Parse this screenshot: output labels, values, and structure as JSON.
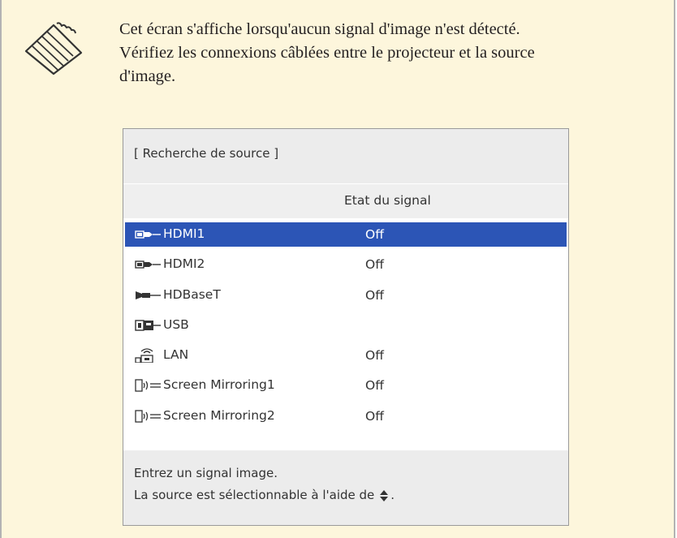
{
  "note": {
    "icon": "note-pencil-icon",
    "lines": [
      "Cet écran s'affiche lorsqu'aucun signal d'image n'est détecté.",
      "Vérifiez les connexions câblées entre le projecteur et la source",
      "d'image."
    ]
  },
  "dialog": {
    "title": "[ Recherche de source ]",
    "column_header": "Etat du signal",
    "rows": [
      {
        "icon": "hdmi-icon",
        "name": "HDMI1",
        "status": "Off",
        "selected": true
      },
      {
        "icon": "hdmi-icon",
        "name": "HDMI2",
        "status": "Off",
        "selected": false
      },
      {
        "icon": "hdbaset-icon",
        "name": "HDBaseT",
        "status": "Off",
        "selected": false
      },
      {
        "icon": "usb-icon",
        "name": "USB",
        "status": "",
        "selected": false
      },
      {
        "icon": "lan-icon",
        "name": "LAN",
        "status": "Off",
        "selected": false
      },
      {
        "icon": "screen-mirroring-icon",
        "name": "Screen Mirroring1",
        "status": "Off",
        "selected": false
      },
      {
        "icon": "screen-mirroring-icon",
        "name": "Screen Mirroring2",
        "status": "Off",
        "selected": false
      }
    ],
    "footer": {
      "line1": "Entrez un signal image.",
      "line2_before": "La source est sélectionnable à l'aide de",
      "line2_icon": "up-down-arrows-icon",
      "line2_after": "."
    }
  },
  "colors": {
    "note_background": "#fdf6dc",
    "selection": "#2c55b6",
    "panel_gray": "#ececec"
  }
}
